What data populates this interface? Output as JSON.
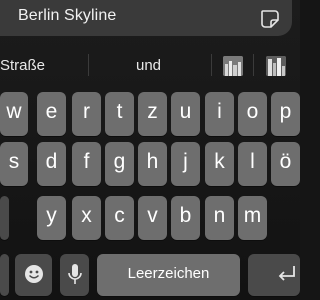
{
  "text_field": {
    "value": "Berlin Skyline",
    "sticker_icon": "sticker-icon"
  },
  "suggestions": {
    "items": [
      "Straße",
      "und"
    ],
    "images": [
      "skyline-thumbnail-1",
      "skyline-thumbnail-2"
    ]
  },
  "keyboard": {
    "row1": [
      "w",
      "e",
      "r",
      "t",
      "z",
      "u",
      "i",
      "o",
      "p"
    ],
    "row2": [
      "s",
      "d",
      "f",
      "g",
      "h",
      "j",
      "k",
      "l",
      "ö"
    ],
    "row3": [
      "y",
      "x",
      "c",
      "v",
      "b",
      "n",
      "m"
    ],
    "emoji_icon": "emoji-icon",
    "mic_icon": "microphone-icon",
    "space_label": "Leerzeichen",
    "return_icon": "return-icon"
  },
  "colors": {
    "key": "#6e6e6e",
    "key_dark": "#4a4a4a",
    "field": "#3a3a3a",
    "background": "#151515"
  }
}
